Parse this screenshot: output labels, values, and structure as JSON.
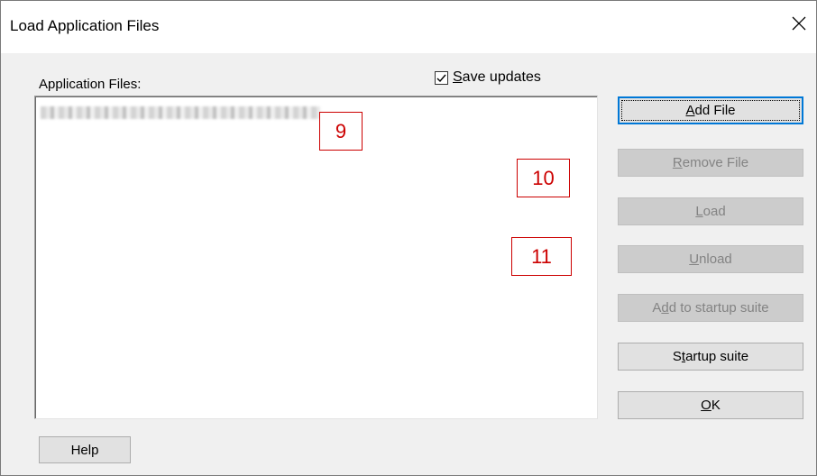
{
  "window": {
    "title": "Load Application Files",
    "close_icon": "close-icon"
  },
  "main": {
    "list_label": "Application Files:",
    "save_updates": {
      "label": "Save updates",
      "checked": true
    },
    "files": [
      {
        "name": "(blurred file path)"
      }
    ]
  },
  "annotations": [
    "9",
    "10",
    "11"
  ],
  "buttons": {
    "add_file": {
      "label": "Add File",
      "enabled": true
    },
    "remove_file": {
      "label": "Remove File",
      "enabled": false
    },
    "load": {
      "label": "Load",
      "enabled": false
    },
    "unload": {
      "label": "Unload",
      "enabled": false
    },
    "add_to_startup": {
      "label": "Add to startup suite",
      "enabled": false
    },
    "startup_suite": {
      "label": "Startup suite",
      "enabled": true
    },
    "ok": {
      "label": "OK",
      "enabled": true
    },
    "help": {
      "label": "Help",
      "enabled": true
    }
  },
  "colors": {
    "marker": "#cc0000",
    "focus": "#0078d7"
  }
}
